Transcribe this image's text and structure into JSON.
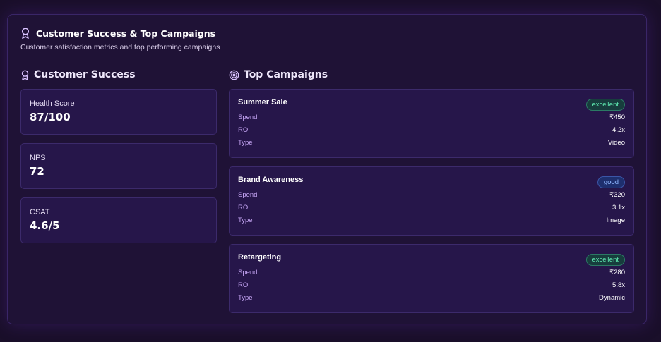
{
  "panel": {
    "title": "Customer Success & Top Campaigns",
    "subtitle": "Customer satisfaction metrics and top performing campaigns",
    "icon": "award-icon"
  },
  "customer_success": {
    "title": "Customer Success",
    "icon": "award-icon",
    "metrics": [
      {
        "label": "Health Score",
        "value": "87/100"
      },
      {
        "label": "NPS",
        "value": "72"
      },
      {
        "label": "CSAT",
        "value": "4.6/5"
      }
    ]
  },
  "top_campaigns": {
    "title": "Top Campaigns",
    "icon": "target-icon",
    "row_labels": {
      "spend": "Spend",
      "roi": "ROI",
      "type": "Type"
    },
    "items": [
      {
        "name": "Summer Sale",
        "badge": "excellent",
        "spend": "₹450",
        "roi": "4.2x",
        "type": "Video"
      },
      {
        "name": "Brand Awareness",
        "badge": "good",
        "spend": "₹320",
        "roi": "3.1x",
        "type": "Image"
      },
      {
        "name": "Retargeting",
        "badge": "excellent",
        "spend": "₹280",
        "roi": "5.8x",
        "type": "Dynamic"
      }
    ]
  },
  "colors": {
    "background": "#1a0f2a",
    "panel": "#1f1236",
    "card": "#26164a",
    "accent": "#c6a6f5",
    "excellent": "#5ee8b0",
    "good": "#8fb6ff"
  }
}
